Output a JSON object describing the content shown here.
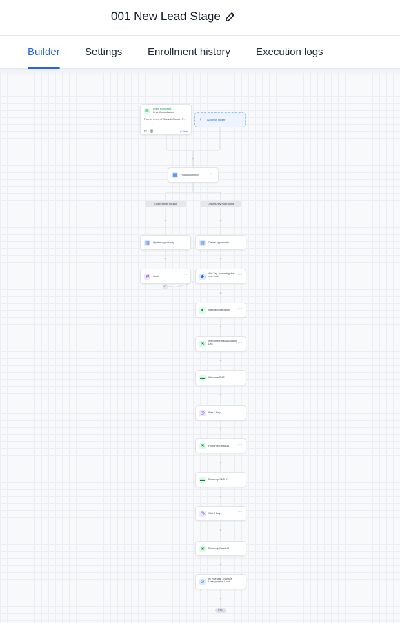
{
  "header": {
    "title": "001 New Lead Stage",
    "edit_icon": "pencil-icon"
  },
  "tabs": [
    {
      "label": "Builder",
      "active": true
    },
    {
      "label": "Settings",
      "active": false
    },
    {
      "label": "Enrollment history",
      "active": false
    },
    {
      "label": "Execution logs",
      "active": false
    }
  ],
  "trigger": {
    "type_label": "Form submitted",
    "name": "Free Consultation",
    "condition": "Form is is any of 'Summit Global - F...",
    "stats_label": "Stats",
    "icon": "form-icon"
  },
  "add_trigger": {
    "label": "Add new trigger"
  },
  "nodes": {
    "find_opportunity": {
      "label": "Find opportunity",
      "icon": "search-document-icon",
      "color": "#2563eb"
    },
    "update_opportunity": {
      "label": "Update opportunity",
      "icon": "opportunity-icon",
      "color": "#2563eb"
    },
    "create_opportunity": {
      "label": "Create opportunity",
      "icon": "opportunity-icon",
      "color": "#2563eb"
    },
    "goto": {
      "label": "Go to",
      "icon": "goto-icon",
      "color": "#a855f7"
    },
    "add_tag": {
      "label": "Add Tag : summit global new lead",
      "icon": "tag-icon",
      "color": "#2563eb"
    },
    "internal_notification": {
      "label": "Internal Notification",
      "icon": "bell-icon",
      "color": "#15803d"
    },
    "welcome_email": {
      "label": "Welcome Email & Booking Link",
      "icon": "email-icon",
      "color": "#15803d"
    },
    "welcome_sms": {
      "label": "Welcome SMS",
      "icon": "sms-icon",
      "color": "#15803d"
    },
    "wait_1": {
      "label": "Wait 1 Day",
      "icon": "clock-icon",
      "color": "#7c3aed"
    },
    "followup_email_1": {
      "label": "Follow up Email #1",
      "icon": "email-icon",
      "color": "#15803d"
    },
    "followup_sms_1": {
      "label": "Follow up SMS #1",
      "icon": "sms-icon",
      "color": "#15803d"
    },
    "wait_3": {
      "label": "Wait 3 Days",
      "icon": "clock-icon",
      "color": "#7c3aed"
    },
    "followup_email_2": {
      "label": "Follow up Email #2",
      "icon": "email-icon",
      "color": "#15803d"
    },
    "if_else": {
      "label": "If / else task - Nurture Unresponsive Lead",
      "icon": "branch-icon",
      "color": "#2563eb"
    }
  },
  "branches": {
    "found": "Opportunity Found",
    "not_found": "Opportunity Not Found"
  },
  "end_label": "END",
  "colors": {
    "accent": "#2563eb",
    "canvas_bg": "#f8f9fb",
    "connector": "#d1d5db"
  }
}
